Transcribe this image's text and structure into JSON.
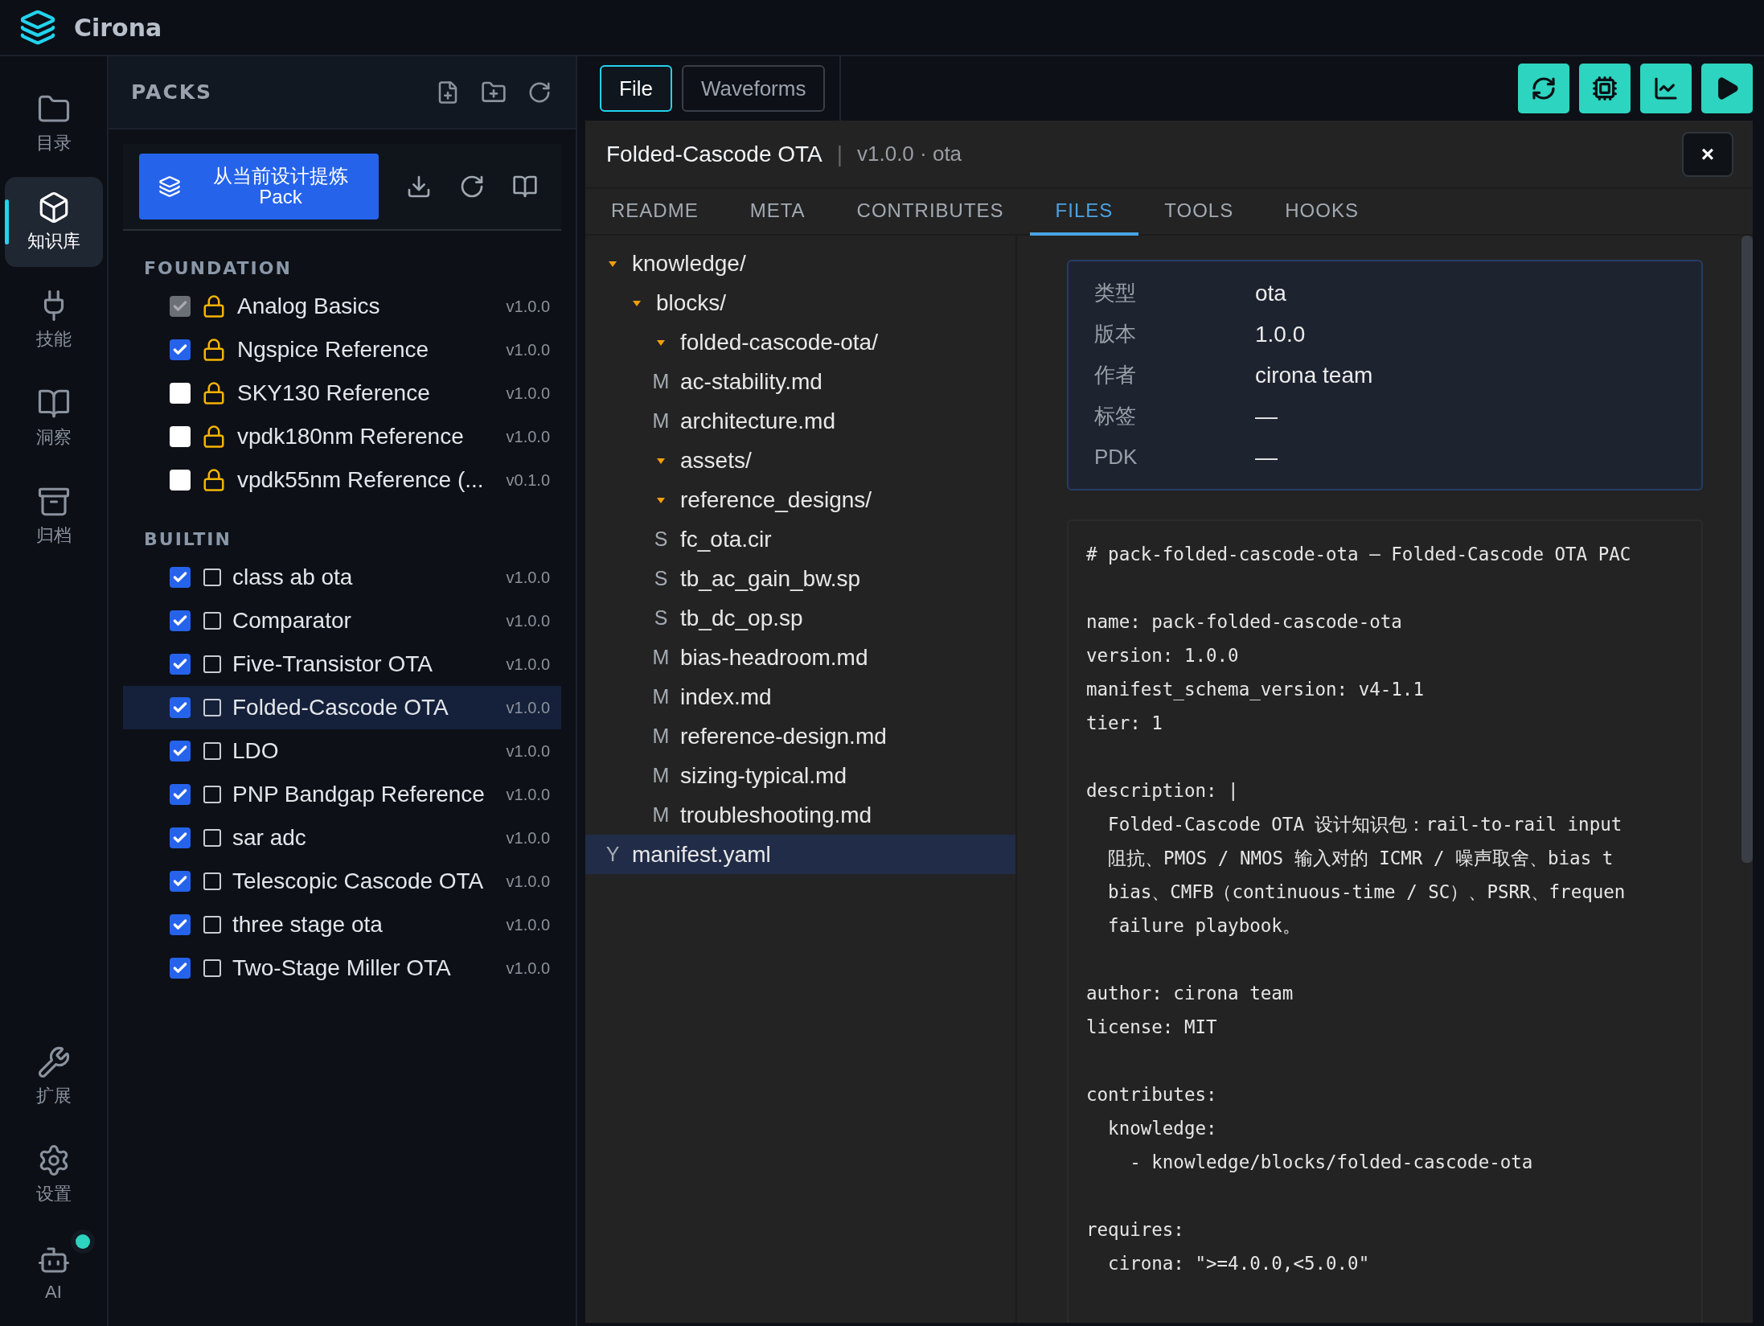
{
  "app": {
    "name": "Cirona"
  },
  "nav": {
    "top": [
      {
        "label": "目录",
        "selected": false
      },
      {
        "label": "知识库",
        "selected": true
      },
      {
        "label": "技能",
        "selected": false
      },
      {
        "label": "洞察",
        "selected": false
      },
      {
        "label": "归档",
        "selected": false
      }
    ],
    "bottom": [
      {
        "label": "扩展",
        "selected": false,
        "online": false
      },
      {
        "label": "设置",
        "selected": false,
        "online": false
      },
      {
        "label": "AI",
        "selected": false,
        "online": true
      }
    ]
  },
  "packs": {
    "title": "PACKS",
    "extract_button": "从当前设计提炼 Pack",
    "sections": [
      {
        "title": "FOUNDATION",
        "items": [
          {
            "name": "Analog Basics",
            "version": "v1.0.0",
            "kind": "locked",
            "checked": true,
            "disabled": true,
            "selected": false
          },
          {
            "name": "Ngspice Reference",
            "version": "v1.0.0",
            "kind": "locked",
            "checked": true,
            "disabled": false,
            "selected": false
          },
          {
            "name": "SKY130 Reference",
            "version": "v1.0.0",
            "kind": "locked",
            "checked": false,
            "disabled": false,
            "selected": false
          },
          {
            "name": "vpdk180nm Reference",
            "version": "v1.0.0",
            "kind": "locked",
            "checked": false,
            "disabled": false,
            "selected": false
          },
          {
            "name": "vpdk55nm Reference (...",
            "version": "v0.1.0",
            "kind": "locked",
            "checked": false,
            "disabled": false,
            "selected": false
          }
        ]
      },
      {
        "title": "BUILTIN",
        "items": [
          {
            "name": "class ab ota",
            "version": "v1.0.0",
            "kind": "marked",
            "checked": true,
            "disabled": false,
            "marked": false,
            "selected": false
          },
          {
            "name": "Comparator",
            "version": "v1.0.0",
            "kind": "marked",
            "checked": true,
            "disabled": false,
            "marked": false,
            "selected": false
          },
          {
            "name": "Five-Transistor OTA",
            "version": "v1.0.0",
            "kind": "marked",
            "checked": true,
            "disabled": false,
            "marked": false,
            "selected": false
          },
          {
            "name": "Folded-Cascode OTA",
            "version": "v1.0.0",
            "kind": "marked",
            "checked": true,
            "disabled": false,
            "marked": false,
            "selected": true
          },
          {
            "name": "LDO",
            "version": "v1.0.0",
            "kind": "marked",
            "checked": true,
            "disabled": false,
            "marked": false,
            "selected": false
          },
          {
            "name": "PNP Bandgap Reference",
            "version": "v1.0.0",
            "kind": "marked",
            "checked": true,
            "disabled": false,
            "marked": false,
            "selected": false
          },
          {
            "name": "sar adc",
            "version": "v1.0.0",
            "kind": "marked",
            "checked": true,
            "disabled": false,
            "marked": false,
            "selected": false
          },
          {
            "name": "Telescopic Cascode OTA",
            "version": "v1.0.0",
            "kind": "marked",
            "checked": true,
            "disabled": false,
            "marked": false,
            "selected": false
          },
          {
            "name": "three stage ota",
            "version": "v1.0.0",
            "kind": "marked",
            "checked": true,
            "disabled": false,
            "marked": false,
            "selected": false
          },
          {
            "name": "Two-Stage Miller OTA",
            "version": "v1.0.0",
            "kind": "marked",
            "checked": true,
            "disabled": false,
            "marked": false,
            "selected": false
          }
        ]
      }
    ]
  },
  "toolbar": {
    "tabs": [
      {
        "label": "File",
        "selected": true
      },
      {
        "label": "Waveforms",
        "selected": false
      }
    ]
  },
  "detail": {
    "title": "Folded-Cascode OTA",
    "separator": "|",
    "subtitle": "v1.0.0 · ota",
    "close": "×",
    "tabs": [
      {
        "label": "README",
        "selected": false
      },
      {
        "label": "META",
        "selected": false
      },
      {
        "label": "CONTRIBUTES",
        "selected": false
      },
      {
        "label": "FILES",
        "selected": true
      },
      {
        "label": "TOOLS",
        "selected": false
      },
      {
        "label": "HOOKS",
        "selected": false
      }
    ],
    "tree": [
      {
        "name": "knowledge/",
        "kind": "folder",
        "expanded": true,
        "selected": false,
        "children": [
          {
            "name": "blocks/",
            "kind": "folder",
            "expanded": true,
            "selected": false,
            "children": [
              {
                "name": "folded-cascode-ota/",
                "kind": "folder",
                "expanded": true,
                "selected": false
              },
              {
                "name": "ac-stability.md",
                "kind": "file",
                "badge": "M",
                "selected": false
              },
              {
                "name": "architecture.md",
                "kind": "file",
                "badge": "M",
                "selected": false
              },
              {
                "name": "assets/",
                "kind": "folder",
                "expanded": true,
                "selected": false
              },
              {
                "name": "reference_designs/",
                "kind": "folder",
                "expanded": true,
                "selected": false
              },
              {
                "name": "fc_ota.cir",
                "kind": "file",
                "badge": "S",
                "selected": false
              },
              {
                "name": "tb_ac_gain_bw.sp",
                "kind": "file",
                "badge": "S",
                "selected": false
              },
              {
                "name": "tb_dc_op.sp",
                "kind": "file",
                "badge": "S",
                "selected": false
              },
              {
                "name": "bias-headroom.md",
                "kind": "file",
                "badge": "M",
                "selected": false
              },
              {
                "name": "index.md",
                "kind": "file",
                "badge": "M",
                "selected": false
              },
              {
                "name": "reference-design.md",
                "kind": "file",
                "badge": "M",
                "selected": false
              },
              {
                "name": "sizing-typical.md",
                "kind": "file",
                "badge": "M",
                "selected": false
              },
              {
                "name": "troubleshooting.md",
                "kind": "file",
                "badge": "M",
                "selected": false
              }
            ]
          }
        ]
      },
      {
        "name": "manifest.yaml",
        "kind": "file",
        "badge": "Y",
        "selected": true
      }
    ],
    "meta": [
      {
        "label": "类型",
        "value": "ota"
      },
      {
        "label": "版本",
        "value": "1.0.0"
      },
      {
        "label": "作者",
        "value": "cirona team"
      },
      {
        "label": "标签",
        "value": "—"
      },
      {
        "label": "PDK",
        "value": "—"
      }
    ],
    "code": "# pack-folded-cascode-ota — Folded-Cascode OTA PAC\n\nname: pack-folded-cascode-ota\nversion: 1.0.0\nmanifest_schema_version: v4-1.1\ntier: 1\n\ndescription: |\n  Folded-Cascode OTA 设计知识包：rail-to-rail input\n  阻抗、PMOS / NMOS 输入对的 ICMR / 噪声取舍、bias t\n  bias、CMFB（continuous-time / SC）、PSRR、frequen\n  failure playbook。\n\nauthor: cirona team\nlicense: MIT\n\ncontributes:\n  knowledge:\n    - knowledge/blocks/folded-cascode-ota\n\nrequires:\n  cirona: \">=4.0.0,<5.0.0\""
  }
}
